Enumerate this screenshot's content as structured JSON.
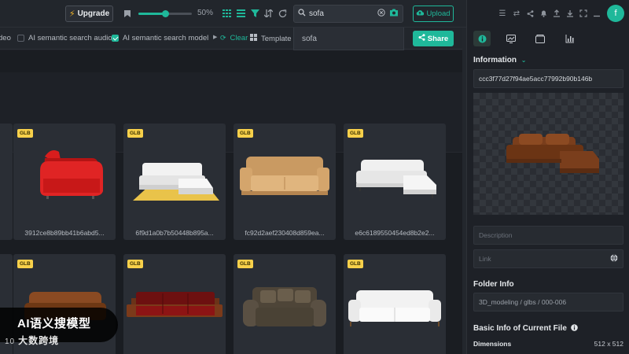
{
  "toolbar": {
    "upgrade_label": "Upgrade",
    "zoom_percent": 50,
    "zoom_label": "50%",
    "search_value": "sofa",
    "upload_label": "Upload"
  },
  "filters": {
    "partial_label": "deo",
    "audio_label": "AI semantic search audio",
    "audio_checked": false,
    "model_label": "AI semantic search model",
    "model_checked": true,
    "clear_label": "Clear",
    "template_label": "Template",
    "share_label": "Share"
  },
  "search_dropdown": {
    "option": "sofa"
  },
  "cards_row1": [
    {
      "badge": "GLB",
      "name": "3912ce8b89bb41b6abd5...",
      "color": "red"
    },
    {
      "badge": "GLB",
      "name": "6f9d1a0b7b50448b895a...",
      "color": "white-floor"
    },
    {
      "badge": "GLB",
      "name": "fc92d2aef230408d859ea...",
      "color": "tan"
    },
    {
      "badge": "GLB",
      "name": "e6c6189550454ed8b2e2...",
      "color": "white"
    }
  ],
  "cards_row2": [
    {
      "badge": "GLB",
      "name": "",
      "color": "brown"
    },
    {
      "badge": "GLB",
      "name": "",
      "color": "maroon"
    },
    {
      "badge": "GLB",
      "name": "",
      "color": "grey-brown"
    },
    {
      "badge": "GLB",
      "name": "",
      "color": "white"
    }
  ],
  "right_panel": {
    "avatar_letter": "f",
    "information_label": "Information",
    "file_id": "ccc3f77d27f94ae5acc77992b90b146b",
    "description_placeholder": "Description",
    "link_placeholder": "Link",
    "folder_info_label": "Folder Info",
    "folder_path": "3D_modeling / glbs / 000-006",
    "basic_info_label": "Basic Info of Current File",
    "dimensions_label": "Dimensions",
    "dimensions_value": "512 x 512"
  },
  "watermark": {
    "title": "AI语义搜模型",
    "logo_text": "大数跨境"
  }
}
